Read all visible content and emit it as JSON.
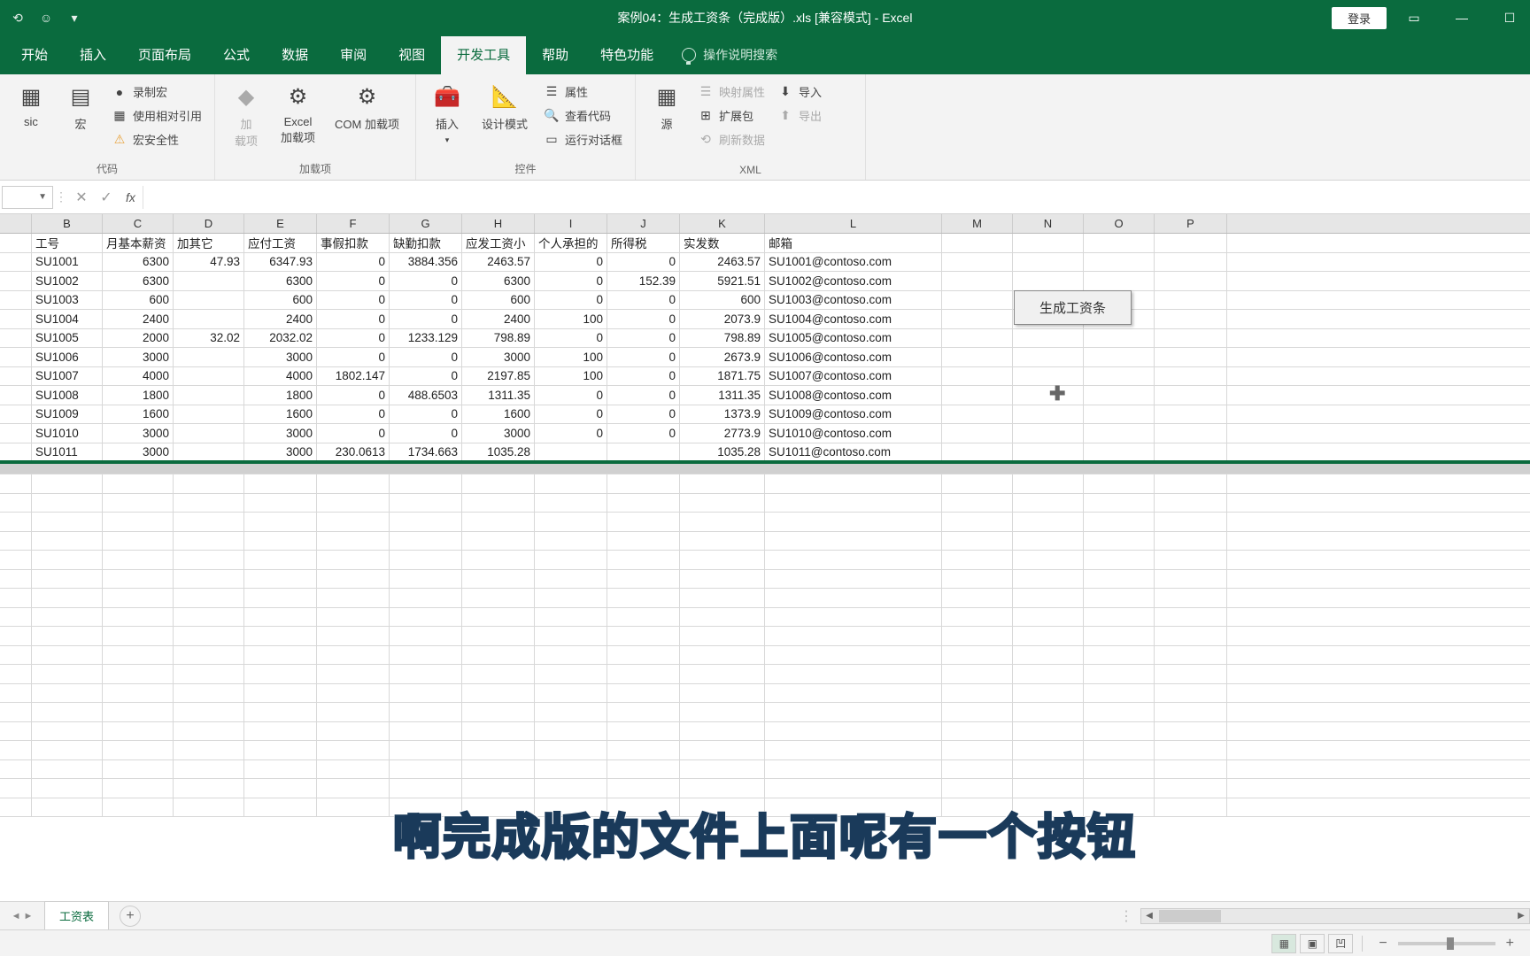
{
  "title": "案例04：生成工资条（完成版）.xls  [兼容模式]  -  Excel",
  "login": "登录",
  "tabs": [
    "开始",
    "插入",
    "页面布局",
    "公式",
    "数据",
    "审阅",
    "视图",
    "开发工具",
    "帮助",
    "特色功能"
  ],
  "active_tab": "开发工具",
  "tell_me": "操作说明搜索",
  "ribbon": {
    "g1": {
      "label": "代码",
      "btn_basic": "sic",
      "btn_macro": "宏",
      "items": [
        "录制宏",
        "使用相对引用",
        "宏安全性"
      ]
    },
    "g2": {
      "label": "加载项",
      "btn_addin": "加\n载项",
      "btn_excel": "Excel\n加载项",
      "btn_com": "COM 加载项"
    },
    "g3": {
      "label": "控件",
      "btn_insert": "插入",
      "btn_design": "设计模式",
      "items": [
        "属性",
        "查看代码",
        "运行对话框"
      ]
    },
    "g4": {
      "label": "XML",
      "btn_source": "源",
      "items_l": [
        "映射属性",
        "扩展包",
        "刷新数据"
      ],
      "items_r": [
        "导入",
        "导出"
      ]
    }
  },
  "columns": [
    "",
    "B",
    "C",
    "D",
    "E",
    "F",
    "G",
    "H",
    "I",
    "J",
    "K",
    "L",
    "M",
    "N",
    "O",
    "P"
  ],
  "headers": [
    "工号",
    "月基本薪资",
    "加其它",
    "应付工资",
    "事假扣款",
    "缺勤扣款",
    "应发工资小",
    "个人承担的",
    "所得税",
    "实发数",
    "邮箱"
  ],
  "rows": [
    {
      "b": "SU1001",
      "c": "6300",
      "d": "47.93",
      "e": "6347.93",
      "f": "0",
      "g": "3884.356",
      "h": "2463.57",
      "i": "0",
      "j": "0",
      "k": "2463.57",
      "l": "SU1001@contoso.com"
    },
    {
      "b": "SU1002",
      "c": "6300",
      "d": "",
      "e": "6300",
      "f": "0",
      "g": "0",
      "h": "6300",
      "i": "0",
      "j": "152.39",
      "k": "5921.51",
      "l": "SU1002@contoso.com"
    },
    {
      "b": "SU1003",
      "c": "600",
      "d": "",
      "e": "600",
      "f": "0",
      "g": "0",
      "h": "600",
      "i": "0",
      "j": "0",
      "k": "600",
      "l": "SU1003@contoso.com"
    },
    {
      "b": "SU1004",
      "c": "2400",
      "d": "",
      "e": "2400",
      "f": "0",
      "g": "0",
      "h": "2400",
      "i": "100",
      "j": "0",
      "k": "2073.9",
      "l": "SU1004@contoso.com"
    },
    {
      "b": "SU1005",
      "c": "2000",
      "d": "32.02",
      "e": "2032.02",
      "f": "0",
      "g": "1233.129",
      "h": "798.89",
      "i": "0",
      "j": "0",
      "k": "798.89",
      "l": "SU1005@contoso.com"
    },
    {
      "b": "SU1006",
      "c": "3000",
      "d": "",
      "e": "3000",
      "f": "0",
      "g": "0",
      "h": "3000",
      "i": "100",
      "j": "0",
      "k": "2673.9",
      "l": "SU1006@contoso.com"
    },
    {
      "b": "SU1007",
      "c": "4000",
      "d": "",
      "e": "4000",
      "f": "1802.147",
      "g": "0",
      "h": "2197.85",
      "i": "100",
      "j": "0",
      "k": "1871.75",
      "l": "SU1007@contoso.com"
    },
    {
      "b": "SU1008",
      "c": "1800",
      "d": "",
      "e": "1800",
      "f": "0",
      "g": "488.6503",
      "h": "1311.35",
      "i": "0",
      "j": "0",
      "k": "1311.35",
      "l": "SU1008@contoso.com"
    },
    {
      "b": "SU1009",
      "c": "1600",
      "d": "",
      "e": "1600",
      "f": "0",
      "g": "0",
      "h": "1600",
      "i": "0",
      "j": "0",
      "k": "1373.9",
      "l": "SU1009@contoso.com"
    },
    {
      "b": "SU1010",
      "c": "3000",
      "d": "",
      "e": "3000",
      "f": "0",
      "g": "0",
      "h": "3000",
      "i": "0",
      "j": "0",
      "k": "2773.9",
      "l": "SU1010@contoso.com"
    },
    {
      "b": "SU1011",
      "c": "3000",
      "d": "",
      "e": "3000",
      "f": "230.0613",
      "g": "1734.663",
      "h": "1035.28",
      "i": "",
      "j": "",
      "k": "1035.28",
      "l": "SU1011@contoso.com"
    }
  ],
  "macro_button": "生成工资条",
  "sheet_tab": "工资表",
  "subtitle": "啊完成版的文件上面呢有一个按钮",
  "fx_label": "fx"
}
